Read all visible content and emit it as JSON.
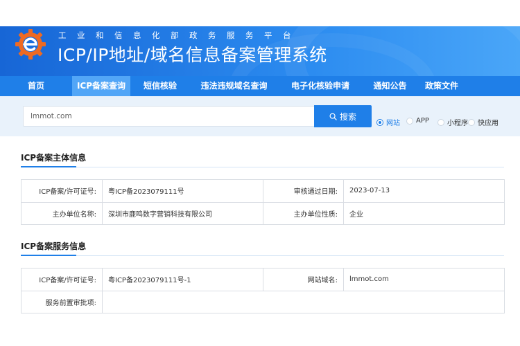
{
  "header": {
    "subtitle": "工业和信息化部政务服务平台",
    "title": "ICP/IP地址/域名信息备案管理系统"
  },
  "nav": {
    "items": [
      {
        "label": "首页",
        "active": false
      },
      {
        "label": "ICP备案查询",
        "active": true
      },
      {
        "label": "短信核验",
        "active": false
      },
      {
        "label": "违法违规域名查询",
        "active": false
      },
      {
        "label": "电子化核验申请",
        "active": false
      },
      {
        "label": "通知公告",
        "active": false
      },
      {
        "label": "政策文件",
        "active": false
      }
    ]
  },
  "search": {
    "value": "lmmot.com",
    "button_label": "搜索",
    "options": [
      {
        "label": "网站",
        "checked": true
      },
      {
        "label": "APP",
        "checked": false
      },
      {
        "label": "小程序",
        "checked": false
      },
      {
        "label": "快应用",
        "checked": false
      }
    ]
  },
  "subject": {
    "title": "ICP备案主体信息",
    "license_label": "ICP备案/许可证号:",
    "license_value": "粤ICP备2023079111号",
    "approve_date_label": "审核通过日期:",
    "approve_date_value": "2023-07-13",
    "org_name_label": "主办单位名称:",
    "org_name_value": "深圳市鹿鸣数字营销科技有限公司",
    "org_type_label": "主办单位性质:",
    "org_type_value": "企业"
  },
  "service": {
    "title": "ICP备案服务信息",
    "license_label": "ICP备案/许可证号:",
    "license_value": "粤ICP备2023079111号-1",
    "domain_label": "网站域名:",
    "domain_value": "lmmot.com",
    "preapproval_label": "服务前置审批项:",
    "preapproval_value": ""
  },
  "colors": {
    "primary": "#1f7fe8",
    "nav_active": "#52a6f7",
    "search_band": "#e9f2fb",
    "logo_orange": "#ee6a22"
  },
  "icons": {
    "logo": "gear-e-logo-icon",
    "search": "search-icon"
  }
}
